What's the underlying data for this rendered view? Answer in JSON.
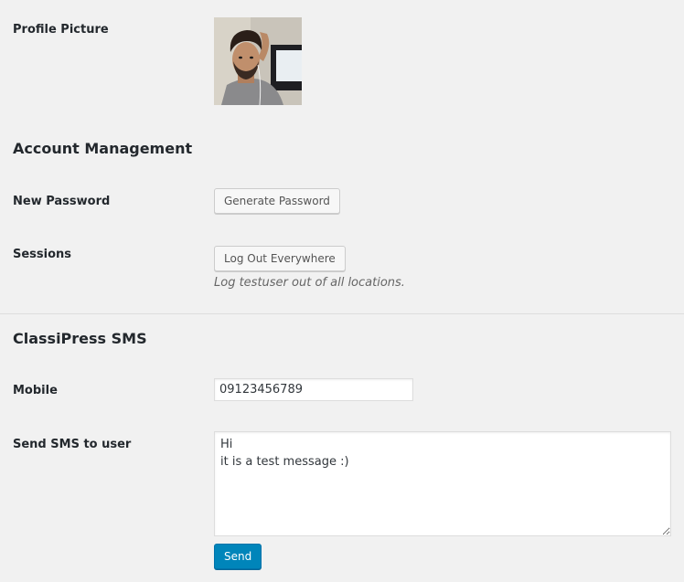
{
  "profile_picture": {
    "label": "Profile Picture"
  },
  "account_management": {
    "heading": "Account Management",
    "new_password_label": "New Password",
    "generate_password_button": "Generate Password",
    "sessions_label": "Sessions",
    "logout_everywhere_button": "Log Out Everywhere",
    "logout_description": "Log testuser out of all locations."
  },
  "classipress_sms": {
    "heading": "ClassiPress SMS",
    "mobile_label": "Mobile",
    "mobile_value": "09123456789",
    "send_sms_label": "Send SMS to user",
    "message_value": "Hi\nit is a test message :)",
    "send_button": "Send"
  },
  "colors": {
    "background": "#f1f1f1",
    "primary_button": "#0085ba",
    "text": "#23282d",
    "description": "#666666"
  }
}
